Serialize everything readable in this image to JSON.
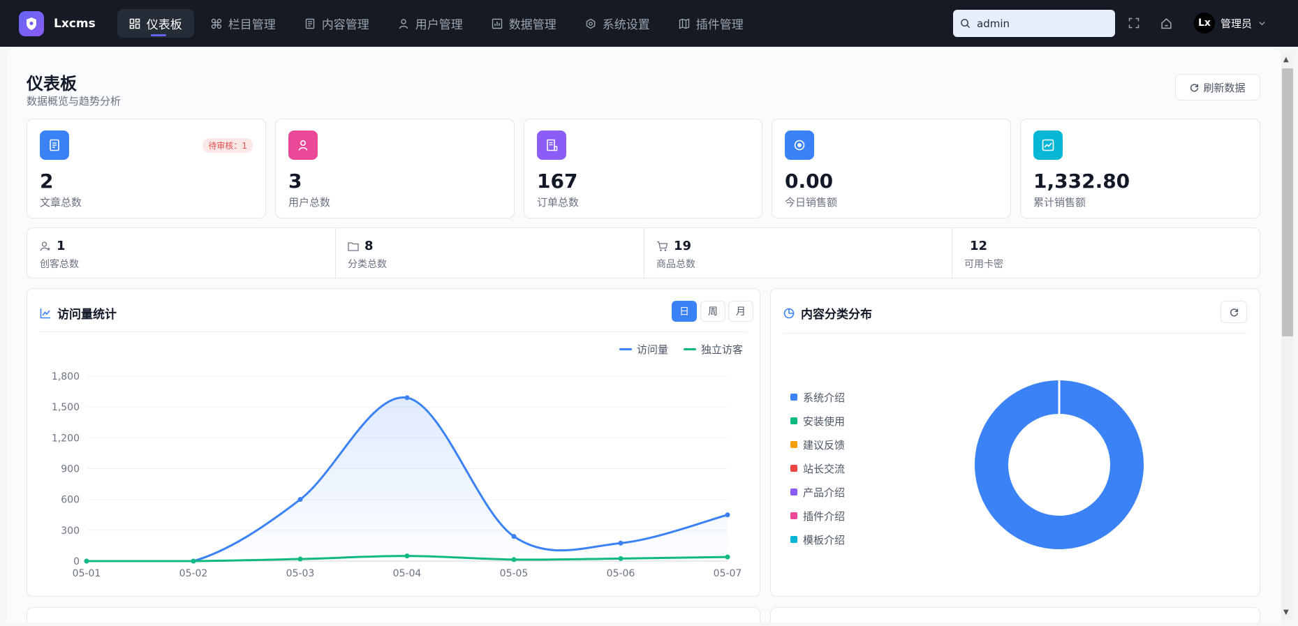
{
  "app": {
    "name": "Lxcms"
  },
  "nav": {
    "items": [
      {
        "label": "仪表板",
        "icon": "dashboard-icon",
        "active": true
      },
      {
        "label": "栏目管理",
        "icon": "grid-command-icon"
      },
      {
        "label": "内容管理",
        "icon": "document-icon"
      },
      {
        "label": "用户管理",
        "icon": "user-icon"
      },
      {
        "label": "数据管理",
        "icon": "bar-chart-icon"
      },
      {
        "label": "系统设置",
        "icon": "gear-icon"
      },
      {
        "label": "插件管理",
        "icon": "map-icon"
      }
    ]
  },
  "search": {
    "value": "admin"
  },
  "user": {
    "avatar_text": "Lx",
    "name": "管理员"
  },
  "page": {
    "title": "仪表板",
    "subtitle": "数据概览与趋势分析",
    "refresh_label": "刷新数据"
  },
  "stats": [
    {
      "value": "2",
      "label": "文章总数",
      "badge": "待审核：1",
      "color": "#3b82f6",
      "icon": "article-icon"
    },
    {
      "value": "3",
      "label": "用户总数",
      "color": "#ec4899",
      "icon": "user-icon"
    },
    {
      "value": "167",
      "label": "订单总数",
      "color": "#8b5cf6",
      "icon": "order-icon"
    },
    {
      "value": "0.00",
      "label": "今日销售额",
      "color": "#3b82f6",
      "icon": "record-icon"
    },
    {
      "value": "1,332.80",
      "label": "累计销售额",
      "color": "#06b6d4",
      "icon": "trend-chart-icon"
    }
  ],
  "mini_stats": [
    {
      "value": "1",
      "label": "创客总数",
      "icon": "user-star-icon"
    },
    {
      "value": "8",
      "label": "分类总数",
      "icon": "folder-icon"
    },
    {
      "value": "19",
      "label": "商品总数",
      "icon": "cart-icon"
    },
    {
      "value": "12",
      "label": "可用卡密",
      "icon": ""
    }
  ],
  "visits_panel": {
    "title": "访问量统计",
    "tabs": [
      "日",
      "周",
      "月"
    ],
    "active_tab": "日"
  },
  "category_panel": {
    "title": "内容分类分布",
    "categories": [
      {
        "name": "系统介绍",
        "color": "#3b82f6"
      },
      {
        "name": "安装使用",
        "color": "#10b981"
      },
      {
        "name": "建议反馈",
        "color": "#f59e0b"
      },
      {
        "name": "站长交流",
        "color": "#ef4444"
      },
      {
        "name": "产品介绍",
        "color": "#8b5cf6"
      },
      {
        "name": "插件介绍",
        "color": "#ec4899"
      },
      {
        "name": "模板介绍",
        "color": "#06b6d4"
      }
    ]
  },
  "chart_data": [
    {
      "type": "area",
      "categories": [
        "05-01",
        "05-02",
        "05-03",
        "05-04",
        "05-05",
        "05-06",
        "05-07"
      ],
      "series": [
        {
          "name": "访问量",
          "values": [
            0,
            0,
            600,
            1590,
            240,
            175,
            450
          ],
          "color": "#3b82f6"
        },
        {
          "name": "独立访客",
          "values": [
            0,
            0,
            20,
            50,
            15,
            25,
            40
          ],
          "color": "#10b981"
        }
      ],
      "ylim": [
        0,
        1800
      ],
      "yticks": [
        "0",
        "300",
        "600",
        "900",
        "1,200",
        "1,500",
        "1,800"
      ],
      "legend": "top-right",
      "grid": true
    },
    {
      "type": "pie",
      "labels": [
        "系统介绍",
        "安装使用",
        "建议反馈",
        "站长交流",
        "产品介绍",
        "插件介绍",
        "模板介绍"
      ],
      "values": [
        100,
        0,
        0,
        0,
        0,
        0,
        0
      ],
      "donut": true,
      "legend": "left"
    }
  ]
}
